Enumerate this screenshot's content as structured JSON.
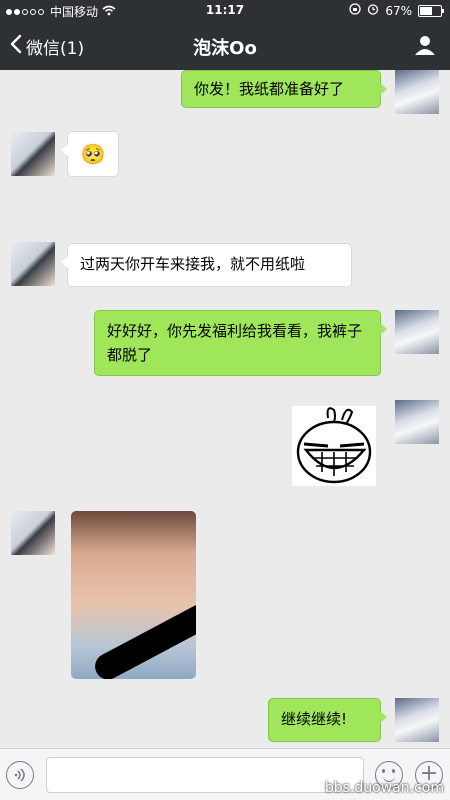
{
  "status_bar": {
    "carrier": "中国移动",
    "time": "11:17",
    "battery": "67%",
    "battery_level": 0.67,
    "signal_icon": "signal-dots-icon",
    "wifi_icon": "wifi-icon",
    "lock_icon": "rotation-lock-icon",
    "alarm_icon": "alarm-icon"
  },
  "nav": {
    "back_label": "微信(1)",
    "title": "泡沫Oo",
    "back_icon": "chevron-left-icon",
    "profile_icon": "person-icon"
  },
  "messages": [
    {
      "side": "right",
      "type": "text",
      "text": "你发！我纸都准备好了"
    },
    {
      "side": "left",
      "type": "emoji",
      "emoji": "🥺"
    },
    {
      "side": "left",
      "type": "text",
      "text": "过两天你开车来接我，就不用纸啦"
    },
    {
      "side": "right",
      "type": "text",
      "text": "好好好，你先发福利给我看看，我裤子都脱了"
    },
    {
      "side": "right",
      "type": "sticker",
      "sticker": "bunny-face-sticker"
    },
    {
      "side": "left",
      "type": "photo",
      "photo": "censored-photo"
    },
    {
      "side": "right",
      "type": "text",
      "text": "继续继续!"
    }
  ],
  "input_bar": {
    "voice_icon": "voice-icon",
    "emoji_icon": "emoji-icon",
    "plus_icon": "plus-icon",
    "text_value": ""
  },
  "watermark": "bbs.duowan.com",
  "colors": {
    "header": "#2e3134",
    "sent_bubble": "#9fe65b",
    "received_bubble": "#ffffff",
    "background": "#ebebeb"
  }
}
